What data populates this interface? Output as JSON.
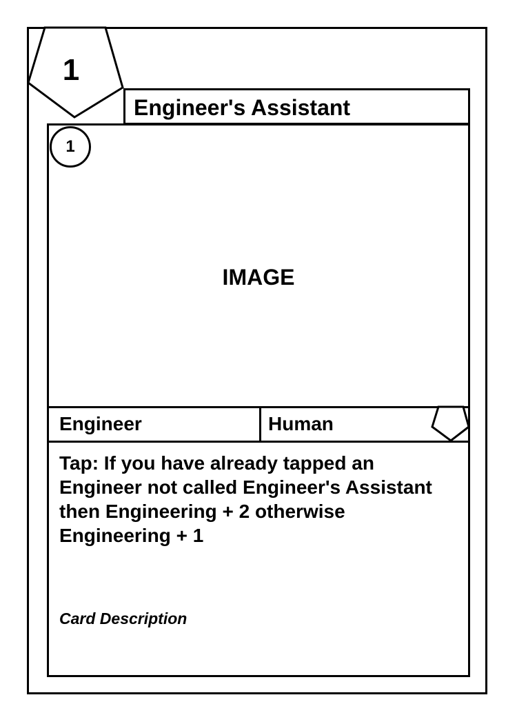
{
  "card": {
    "cost": "1",
    "title": "Engineer's Assistant",
    "level": "1",
    "image_placeholder": "IMAGE",
    "type_left": "Engineer",
    "type_right": "Human",
    "ability_text": "Tap: If you have already tapped an Engineer not called Engineer's Assistant then Engineering + 2 otherwise Engineering + 1",
    "description": "Card Description"
  },
  "icons": {
    "cost_badge": "pentagon-icon",
    "type_badge": "pentagon-icon"
  },
  "colors": {
    "line": "#000000",
    "background": "#ffffff"
  }
}
